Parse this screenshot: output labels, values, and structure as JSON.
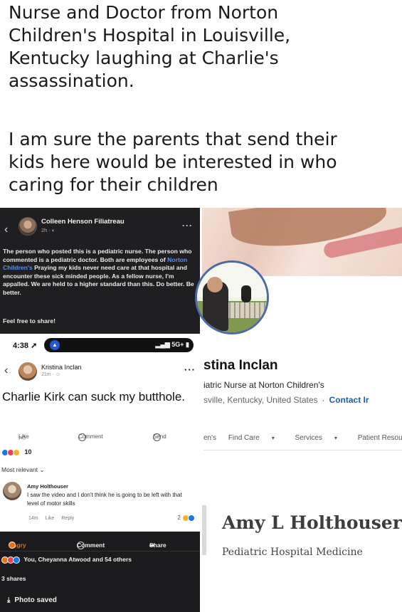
{
  "header": {
    "headline": "Nurse and Doctor from Norton\nChildren's Hospital in Louisville,\nKentucky laughing at Charlie's\nassassination.",
    "subline": "I am sure the parents that send their\nkids here would be interested in who\ncaring for their children"
  },
  "repost": {
    "author": "Colleen Henson Filiatreau",
    "meta": "2h · ",
    "body_pre": "The person who posted this is a pediatric nurse. The person who commented is a pediatric doctor. Both are employees of ",
    "body_link": "Norton Children's",
    "body_post": " Praying my kids never need care at that hospital and encounter these sick minded people. As a fellow nurse, I'm appalled. We are held to a higher standard than this. Do better. Be better.",
    "share_line": "Feel free to share!"
  },
  "statusbar": {
    "time": "4:38",
    "signal": "5G+"
  },
  "post": {
    "author": "Kristina Inclan",
    "meta": "21m · ",
    "text": "Charlie Kirk can suck my butthole.",
    "like_label": "Like",
    "comment_label": "Comment",
    "send_label": "Send",
    "reaction_count": "10",
    "sort_label": "Most relevant",
    "comment": {
      "author": "Amy Holthouser",
      "text": "I saw the video and I don't think he is going to be left with that level of motor skills",
      "time": "14m",
      "like": "Like",
      "reply": "Reply",
      "count": "2"
    }
  },
  "bottom": {
    "angry_label": "Angry",
    "comment_label": "Comment",
    "share_label": "Share",
    "reactors": "You, Cheyanna Atwood and 54 others",
    "shares": "3 shares",
    "saved": "Photo saved"
  },
  "profile": {
    "name": "stina Inclan",
    "title": "iatric Nurse at Norton Children's",
    "location": "sville, Kentucky, United States",
    "separator": "·",
    "contact": "Contact Ir"
  },
  "site_nav": {
    "items": [
      "en's",
      "Find Care",
      "Services",
      "Patient Resource"
    ]
  },
  "doctor": {
    "name": "Amy L Holthouser",
    "specialty": "Pediatric Hospital Medicine"
  },
  "colors": {
    "fb_dark": "#1f1f21",
    "fb_link": "#5b8ef0",
    "profile_ring": "#4d6aa8",
    "contact_link": "#1b5fb5",
    "angry": "#e9710f"
  }
}
